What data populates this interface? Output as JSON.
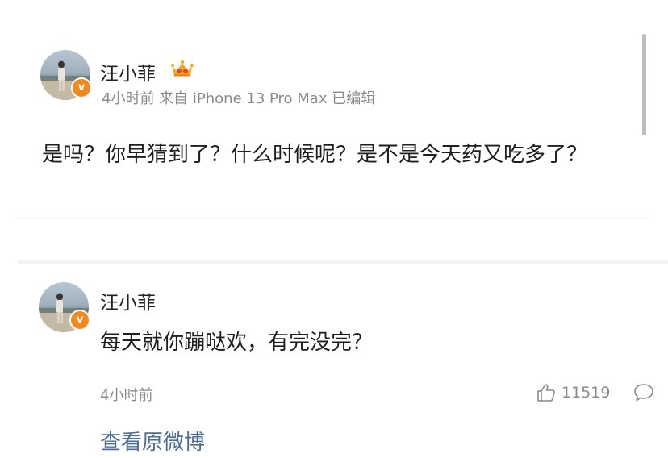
{
  "post": {
    "author": "汪小菲",
    "verified_badge": "v",
    "meta": "4小时前 来自 iPhone 13 Pro Max 已编辑",
    "text": "是吗？你早猜到了？什么时候呢？是不是今天药又吃多了？"
  },
  "reply": {
    "author": "汪小菲",
    "verified_badge": "v",
    "text": "每天就你蹦哒欢，有完没完？",
    "time": "4小时前",
    "like_count": "11519",
    "view_original_label": "查看原微博"
  },
  "icons": {
    "crown": "crown-icon",
    "like": "thumbs-up-icon",
    "comment": "comment-icon",
    "verified": "verified-v-icon"
  },
  "colors": {
    "link": "#4d6c96",
    "verified_badge": "#f08a1e",
    "crown": "#f5a623",
    "muted_text": "#8a8a8a"
  }
}
